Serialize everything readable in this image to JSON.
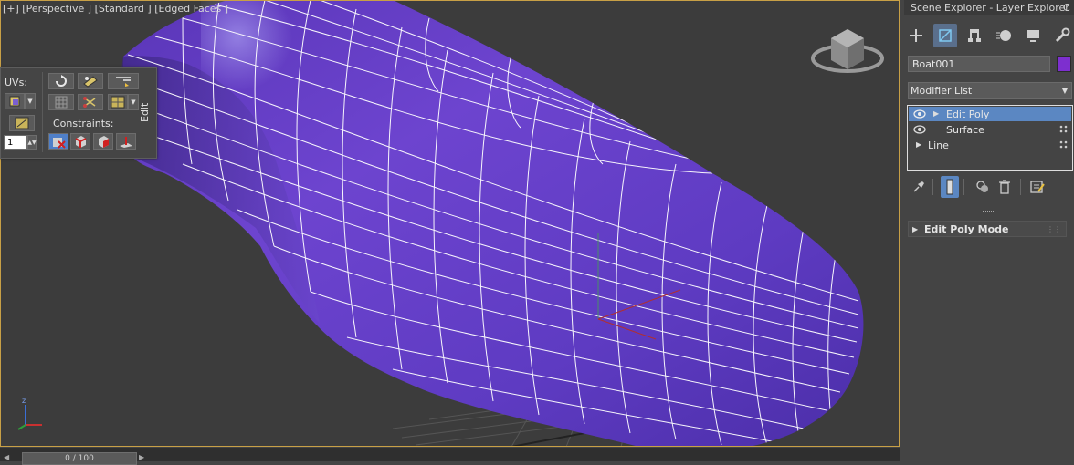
{
  "viewport": {
    "label": "[+] [Perspective ] [Standard ] [Edged Faces ]",
    "object_color": "#6a3fc8",
    "wire_color": "#ffffff",
    "border_color": "#c8a046",
    "axis_labels": {
      "z": "z"
    }
  },
  "uv_toolbar": {
    "uvs_label": "UVs:",
    "constraints_label": "Constraints:",
    "spinner_value": "1",
    "edit_label": "Edit"
  },
  "timeline": {
    "slider_text": "0 / 100"
  },
  "panel": {
    "tab_label": "Scene Explorer - Layer Explorer",
    "tab_extra": "C",
    "command_tabs": [
      "create-icon",
      "modify-icon",
      "hierarchy-icon",
      "motion-icon",
      "display-icon",
      "utilities-icon"
    ],
    "object_name": "Boat001",
    "object_color": "#7d2fcf",
    "modifier_list_label": "Modifier List",
    "stack": [
      {
        "label": "Edit Poly",
        "selected": true
      },
      {
        "label": "Surface",
        "selected": false
      },
      {
        "label": "Line",
        "selected": false
      }
    ],
    "rollout_label": "Edit Poly Mode"
  }
}
